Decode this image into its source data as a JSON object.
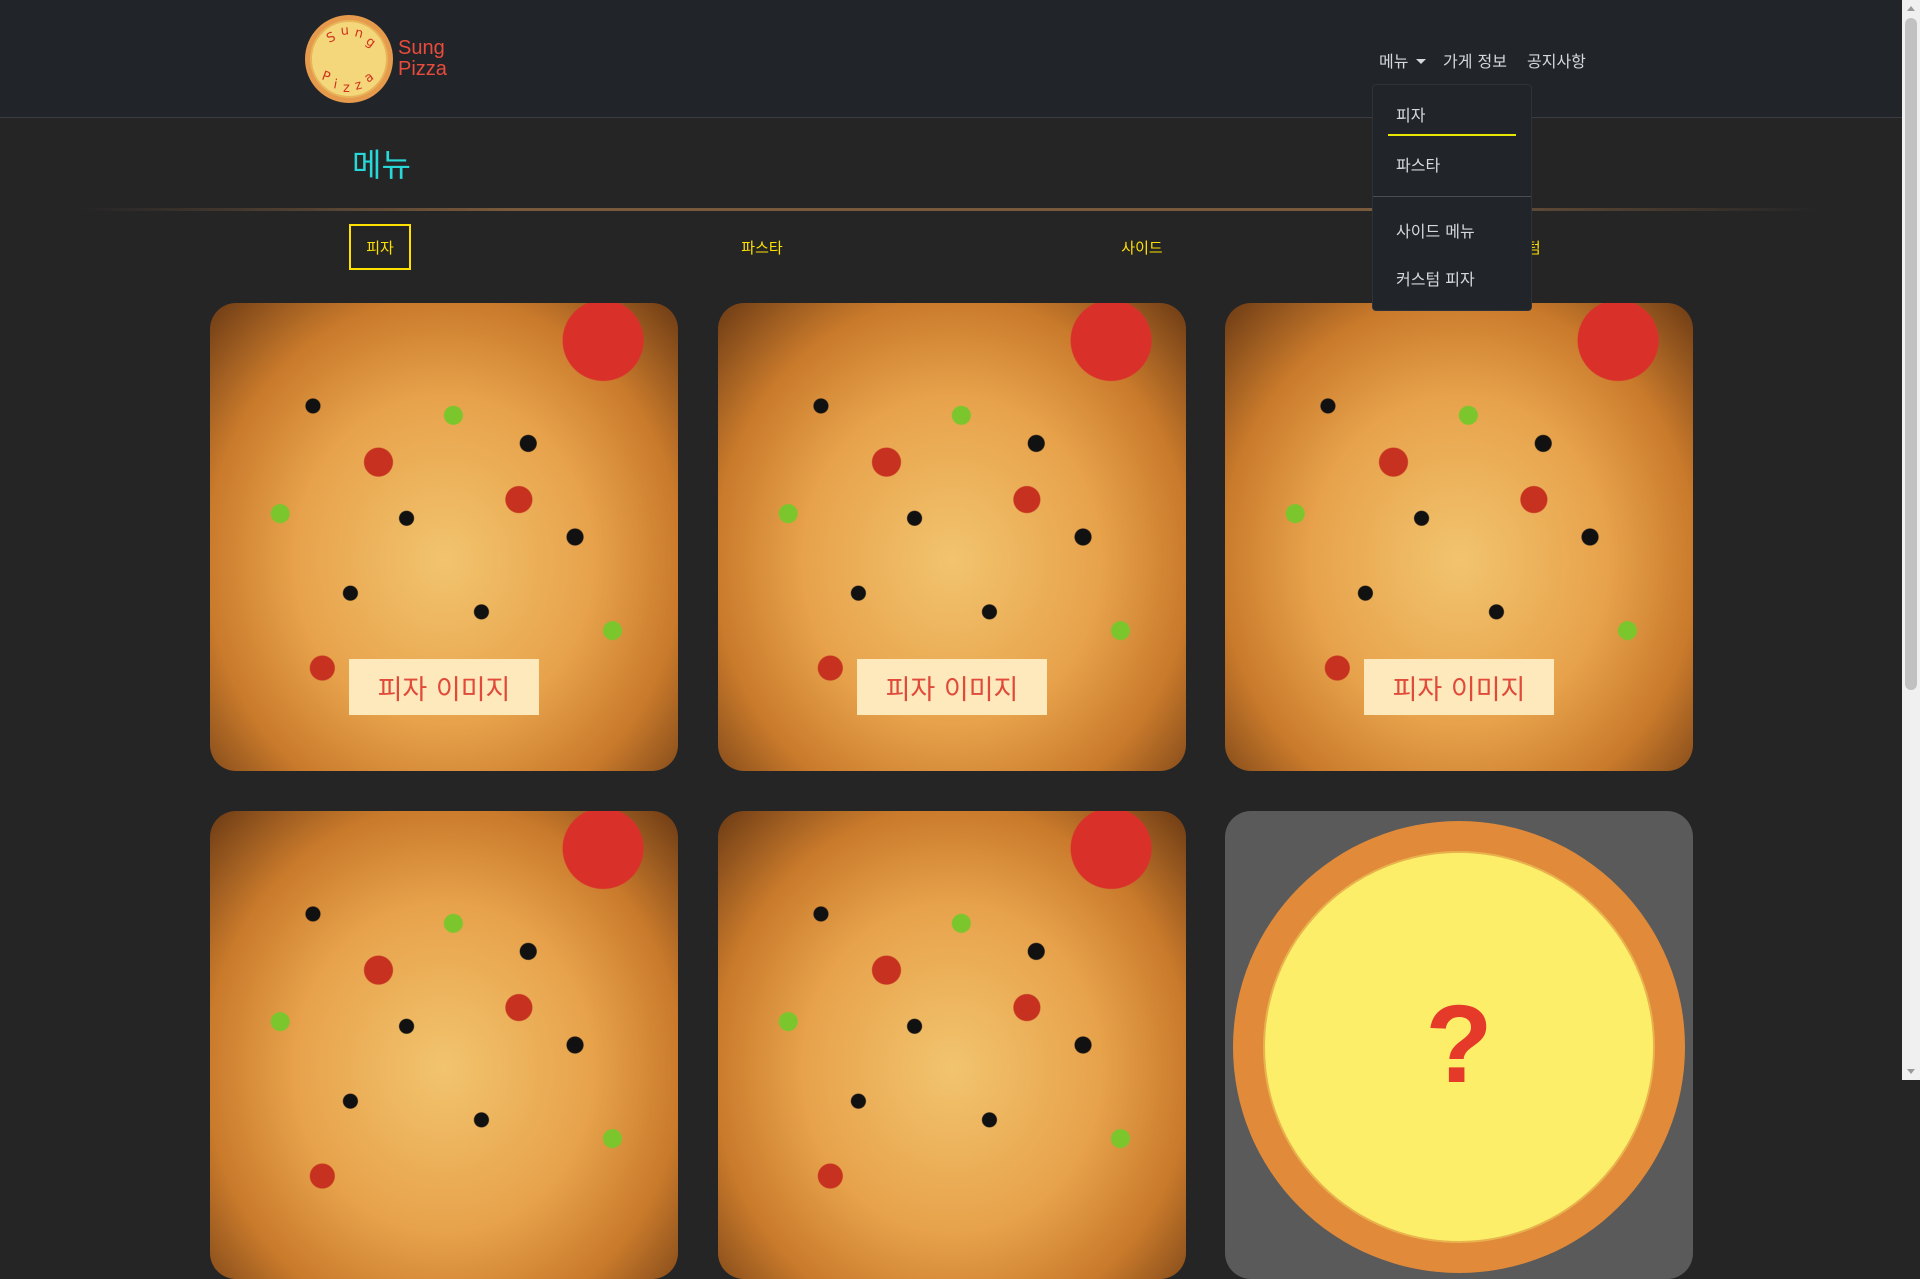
{
  "brand": {
    "logo_text": "Sung Pizza",
    "line1": "Sung",
    "line2": "Pizza"
  },
  "nav": {
    "menu": "메뉴",
    "store_info": "가게 정보",
    "notice": "공지사항"
  },
  "dropdown": [
    "피자",
    "파스타",
    "사이드 메뉴",
    "커스텀 피자"
  ],
  "page": {
    "title": "메뉴"
  },
  "tabs": [
    "피자",
    "파스타",
    "사이드",
    "커스텀"
  ],
  "cards": [
    {
      "label": "피자 이미지"
    },
    {
      "label": "피자 이미지"
    },
    {
      "label": "피자 이미지"
    }
  ],
  "custom_card": {
    "symbol": "?"
  },
  "colors": {
    "accent": "#ffe100",
    "title": "#28d7d7",
    "brand": "#e94b3c",
    "label_bg": "#fde9bb"
  }
}
